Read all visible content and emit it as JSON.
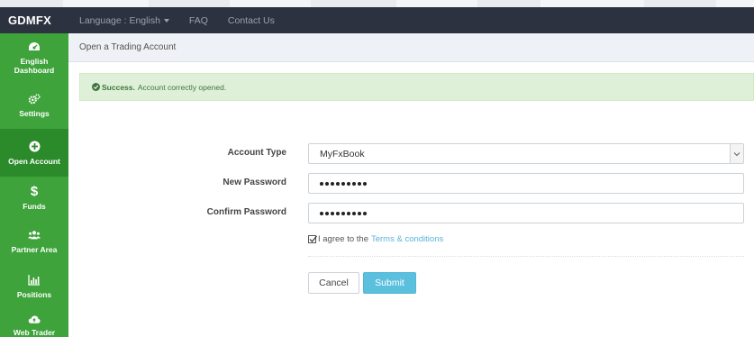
{
  "navbar": {
    "brand": "GDMFX",
    "language_label": "Language : English",
    "faq": "FAQ",
    "contact": "Contact Us"
  },
  "sidebar": {
    "items": [
      {
        "label_line1": "English",
        "label_line2": "Dashboard",
        "icon": "dashboard-icon"
      },
      {
        "label_line1": "Settings",
        "label_line2": "",
        "icon": "gears-icon"
      },
      {
        "label_line1": "Open Account",
        "label_line2": "",
        "icon": "plus-circle-icon",
        "active": true
      },
      {
        "label_line1": "Funds",
        "label_line2": "",
        "icon": "dollar-icon"
      },
      {
        "label_line1": "Partner Area",
        "label_line2": "",
        "icon": "users-icon"
      },
      {
        "label_line1": "Positions",
        "label_line2": "",
        "icon": "bar-chart-icon"
      },
      {
        "label_line1": "Web Trader",
        "label_line2": "",
        "icon": "cloud-upload-icon"
      }
    ]
  },
  "breadcrumb": "Open a Trading Account",
  "alert": {
    "strong": "Success.",
    "message": "Account correctly opened."
  },
  "form": {
    "account_type_label": "Account Type",
    "account_type_value": "MyFxBook",
    "new_password_label": "New Password",
    "confirm_password_label": "Confirm Password",
    "agree_text": "I agree to the",
    "terms_link": "Terms & conditions",
    "cancel_label": "Cancel",
    "submit_label": "Submit"
  },
  "colors": {
    "sidebar": "#3ea33a",
    "sidebar_active": "#2b8a29",
    "navbar": "#2c3240",
    "alert_bg": "#dff0d8",
    "alert_text": "#3c763d",
    "submit": "#5bc0de",
    "link": "#5bb4d9"
  }
}
